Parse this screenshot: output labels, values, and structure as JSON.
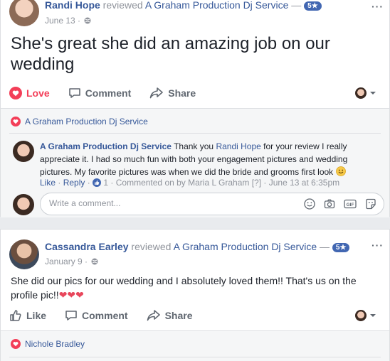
{
  "post1": {
    "author": "Randi Hope",
    "verb": "reviewed",
    "page": "A Graham Production Dj Service",
    "dash": "—",
    "rating": "5★",
    "date": "June 13 ·",
    "text": "She's great she did an amazing job on our wedding",
    "actions": {
      "reaction": "Love",
      "comment": "Comment",
      "share": "Share"
    },
    "reactions_by": "A Graham Production Dj Service",
    "comment": {
      "author": "A Graham Production Dj Service",
      "text_a": " Thank you ",
      "mention": "Randi Hope",
      "text_b": " for your review I really appreciate it. I had so much fun with both your engagement pictures and wedding pictures. My favorite pictures was when we did the bride and grooms first look",
      "meta": {
        "like": "Like",
        "sep1": " · ",
        "reply": "Reply",
        "sep2": " · ",
        "like_count": "1",
        "commented_on": " · Commented on by Maria L Graham",
        "q": " [?]",
        "time": " · June 13 at 6:35pm"
      }
    },
    "write_placeholder": "Write a comment..."
  },
  "post2": {
    "author": "Cassandra Earley",
    "verb": "reviewed",
    "page": "A Graham Production Dj Service",
    "dash": "—",
    "rating": "5★",
    "date": "January 9 ·",
    "text": "She did our pics for our wedding and I absolutely loved them!! That's us on the profile pic!!",
    "hearts": "❤❤❤",
    "actions": {
      "reaction": "Like",
      "comment": "Comment",
      "share": "Share"
    },
    "reactions_by": "Nichole Bradley"
  },
  "colors": {
    "link": "#365899",
    "love": "#f33e58",
    "muted": "#90949c",
    "badge": "#4267b2"
  }
}
